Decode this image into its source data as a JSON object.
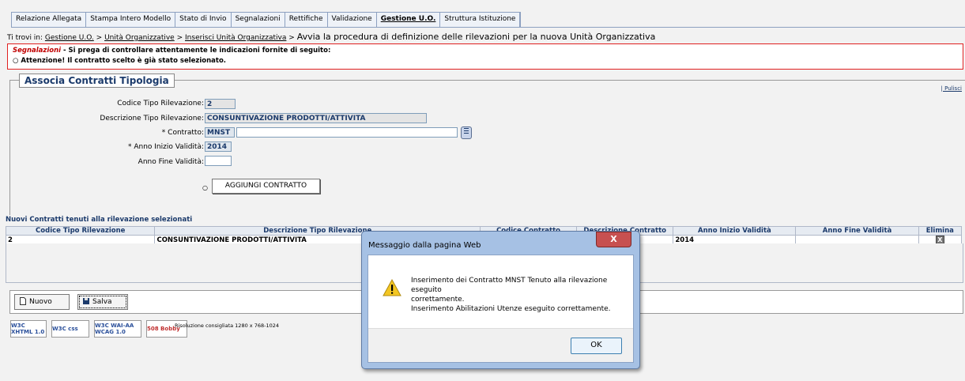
{
  "nav": {
    "tabs": [
      {
        "label": "Relazione Allegata"
      },
      {
        "label": "Stampa Intero Modello"
      },
      {
        "label": "Stato di Invio"
      },
      {
        "label": "Segnalazioni"
      },
      {
        "label": "Rettifiche"
      },
      {
        "label": "Validazione"
      },
      {
        "label": "Gestione U.O."
      },
      {
        "label": "Struttura Istituzione"
      }
    ]
  },
  "breadcrumb": {
    "prefix": "Ti trovi in:",
    "items": [
      "Gestione U.O.",
      "Unità Organizzative",
      "Inserisci Unità Organizzativa"
    ],
    "separator": ">",
    "current": "Avvia la procedura di definizione delle rilevazioni per la nuova Unità Organizzativa"
  },
  "alert": {
    "title": "Segnalazioni",
    "intro": " - Si prega di controllare attentamente le indicazioni fornite di seguito:",
    "message": "○  Attenzione! Il contratto scelto è già stato selezionato."
  },
  "form": {
    "legend": "Associa Contratti Tipologia",
    "pulisci": "| Pulisci",
    "codice_label": "Codice Tipo Rilevazione:",
    "codice_value": "2",
    "descrizione_label": "Descrizione Tipo Rilevazione:",
    "descrizione_value": "CONSUNTIVAZIONE PRODOTTI/ATTIVITA",
    "contratto_label": "* Contratto:",
    "contratto_value": "MNST",
    "anno_inizio_label": "* Anno Inizio Validità:",
    "anno_inizio_value": "2014",
    "anno_fine_label": "Anno Fine Validità:",
    "anno_fine_value": "",
    "bullet": "○",
    "aggiungi_label": "AGGIUNGI CONTRATTO"
  },
  "table": {
    "title": "Nuovi Contratti tenuti alla rilevazione selezionati",
    "headers": [
      "Codice Tipo Rilevazione",
      "Descrizione Tipo Rilevazione",
      "Codice Contratto",
      "Descrizione Contratto",
      "Anno Inizio Validità",
      "Anno Fine Validità",
      "Elimina"
    ],
    "rows": [
      {
        "codice": "2",
        "descrizione": "CONSUNTIVAZIONE PRODOTTI/ATTIVITA",
        "codice_contratto": "",
        "descrizione_contratto": "",
        "anno_inizio": "2014",
        "anno_fine": "",
        "elimina": "X"
      }
    ]
  },
  "buttons": {
    "nuovo": "Nuovo",
    "salva": "Salva"
  },
  "footer": {
    "badges": [
      "W3C XHTML 1.0",
      "W3C css",
      "W3C WAI-AA WCAG 1.0",
      "508 Bobby"
    ],
    "risoluzione": "Risoluzione consigliata 1280 x 768-1024"
  },
  "dialog": {
    "title": "Messaggio dalla pagina Web",
    "close": "X",
    "line1": "Inserimento dei Contratto MNST Tenuto alla rilevazione eseguito",
    "line2": "correttamente.",
    "line3": "Inserimento Abilitazioni Utenze eseguito correttamente.",
    "ok": "OK"
  },
  "colors": {
    "accent": "#1b3a6b",
    "alert_border": "#e02020",
    "dialog_frame": "#a6c1e4"
  }
}
